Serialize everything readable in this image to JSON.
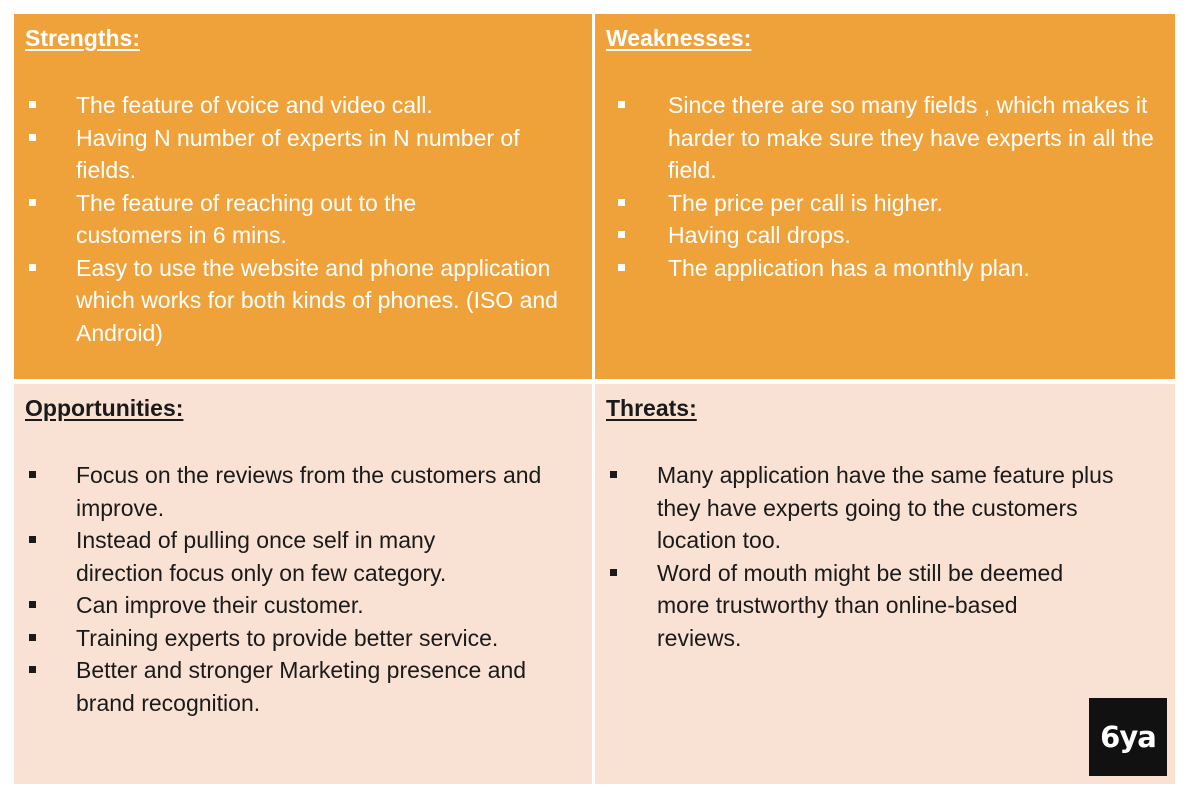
{
  "strengths": {
    "heading": "Strengths:",
    "items": [
      "The feature of voice and video call.",
      "Having N number of experts in N number of fields.",
      "The feature of reaching out to the customers in 6 mins.",
      "Easy to use the website and phone application which works for both kinds of phones. (ISO and Android)"
    ]
  },
  "weaknesses": {
    "heading": "Weaknesses:",
    "items": [
      "Since there are so many fields , which makes it harder to make sure they have experts in all the field.",
      "The price per call is higher.",
      "Having call drops.",
      "The application has a monthly plan."
    ]
  },
  "opportunities": {
    "heading": "Opportunities:",
    "items": [
      "Focus on the reviews from the customers and improve.",
      "Instead of pulling once self in many direction focus only on few category.",
      "Can improve their customer.",
      "Training experts to provide better service.",
      "Better and stronger Marketing presence and brand recognition."
    ]
  },
  "threats": {
    "heading": "Threats:",
    "items": [
      "Many application have the same feature plus they have experts going to the customers location too.",
      "Word of mouth might be still be deemed more trustworthy than online-based reviews."
    ]
  },
  "logo": {
    "text": "6ya"
  },
  "colors": {
    "top_quadrant": "#efa23a",
    "bottom_quadrant": "#f9e2d3"
  }
}
